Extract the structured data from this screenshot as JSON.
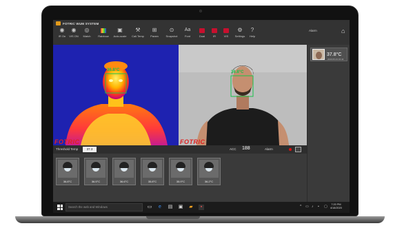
{
  "app": {
    "title": "FOTRIC WUM SYSTEM",
    "alarm_label": "Alarm",
    "home_icon": "home-icon"
  },
  "toolbar": {
    "items": [
      {
        "label": "IR On",
        "icon": "ir-camera-icon"
      },
      {
        "label": "VIS ON",
        "icon": "visible-camera-icon"
      },
      {
        "label": "Match",
        "icon": "match-icon"
      },
      {
        "label": "Rainbow",
        "icon": "palette-icon"
      },
      {
        "label": "Auto-scale",
        "icon": "auto-scale-icon"
      },
      {
        "label": "Cali.Temp",
        "icon": "calibrate-icon"
      },
      {
        "label": "Param",
        "icon": "param-icon"
      },
      {
        "label": "Snapshot",
        "icon": "camera-icon"
      },
      {
        "label": "Font",
        "icon": "font-icon"
      },
      {
        "label": "Dual",
        "icon": "dual-view-icon"
      },
      {
        "label": "IR",
        "icon": "ir-view-icon"
      },
      {
        "label": "VIS",
        "icon": "vis-view-icon"
      },
      {
        "label": "Settings",
        "icon": "gear-icon"
      },
      {
        "label": "Help",
        "icon": "help-icon"
      }
    ]
  },
  "ir_view": {
    "temp_label": "36.8°C",
    "watermark": "FOTRIC"
  },
  "vis_view": {
    "temp_label": "36.8°C",
    "watermark": "FOTRIC"
  },
  "side_panel": {
    "latest_temp": "37.8°C",
    "latest_date": "2020.05.23 15:44"
  },
  "controls": {
    "threshold_label": "Threshold Temp",
    "threshold_value": "37.3",
    "acc_label": "ACC",
    "acc_value": "188",
    "alarm_label": "Alarm"
  },
  "snapshots": [
    {
      "temp": "36.8°C"
    },
    {
      "temp": "36.5°C"
    },
    {
      "temp": "36.6°C"
    },
    {
      "temp": "35.8°C"
    },
    {
      "temp": "35.9°C"
    },
    {
      "temp": "36.2°C"
    }
  ],
  "taskbar": {
    "search_placeholder": "Search the web and Windows",
    "time": "7:20 PM",
    "date": "4/18/2020"
  },
  "colors": {
    "accent_green": "#19c24a",
    "alarm_red": "#d11111",
    "brand_orange": "#e39b1b"
  }
}
